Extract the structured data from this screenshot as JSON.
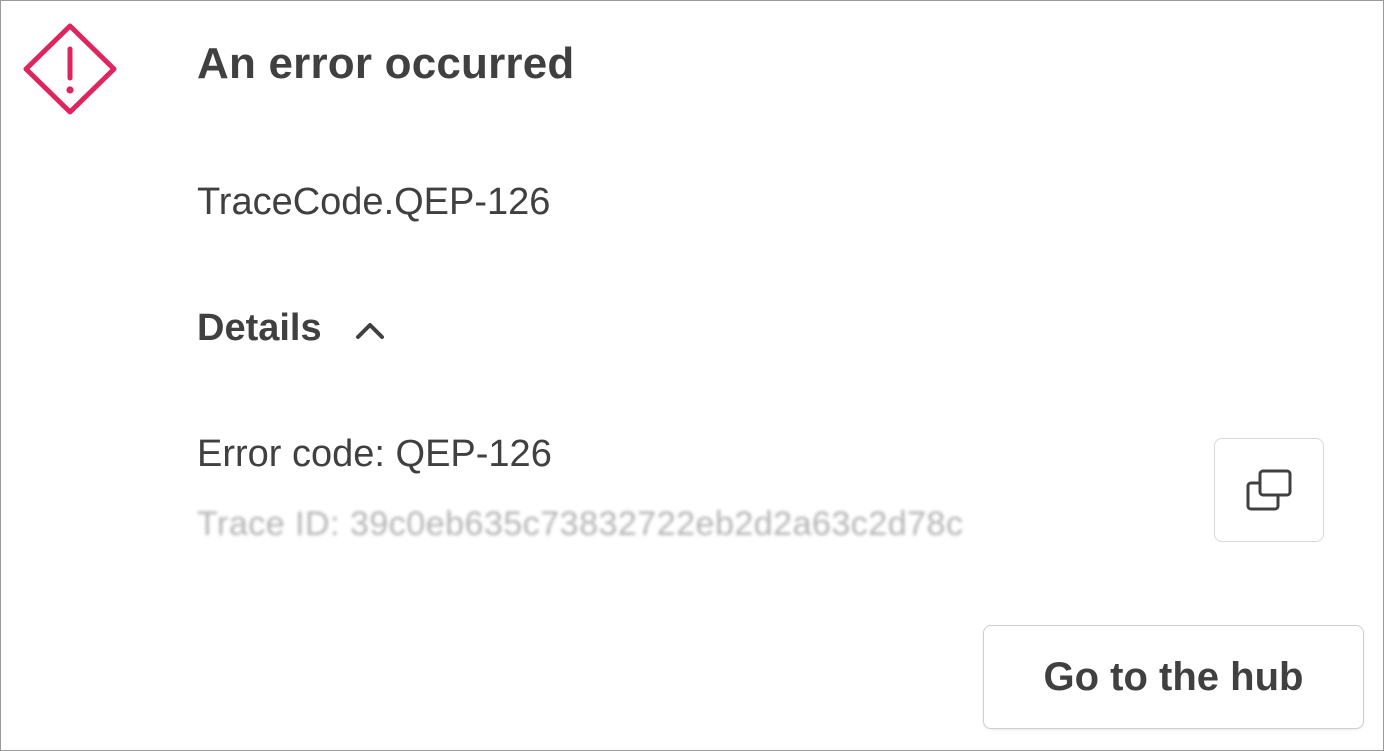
{
  "dialog": {
    "title": "An error occurred",
    "trace_code": "TraceCode.QEP-126",
    "details_label": "Details",
    "details_expanded": true,
    "error_code": "Error code: QEP-126",
    "trace_id": "Trace ID: 39c0eb635c73832722eb2d2a63c2d78c",
    "go_to_hub_label": "Go to the hub"
  },
  "icons": {
    "warning": "warning-diamond-icon",
    "chevron": "chevron-up-icon",
    "copy": "copy-icon"
  },
  "colors": {
    "warning_accent": "#e0245e",
    "text_primary": "#404040",
    "text_blurred": "#b4b4b4",
    "border": "#d9d9d9"
  }
}
